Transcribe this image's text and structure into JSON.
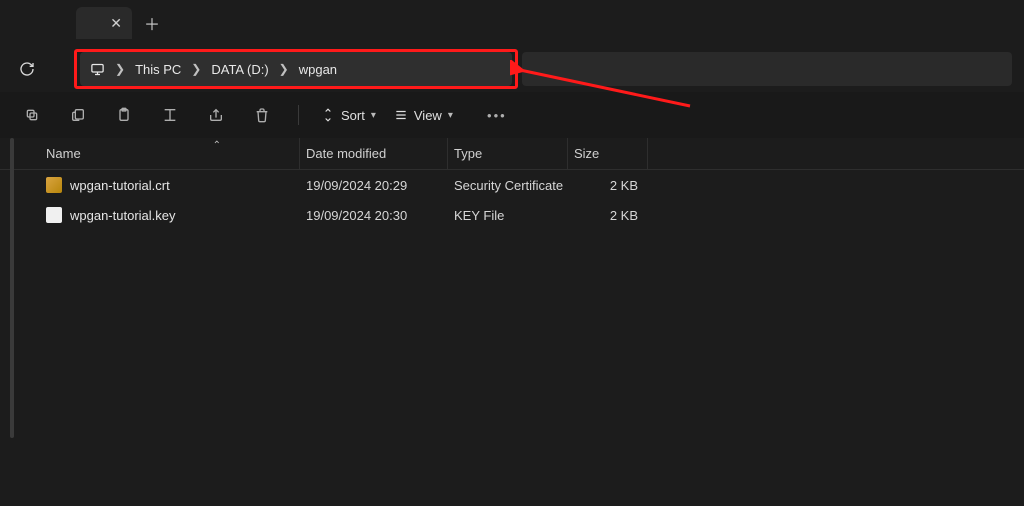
{
  "breadcrumb": {
    "items": [
      "This PC",
      "DATA (D:)",
      "wpgan"
    ]
  },
  "toolbar": {
    "sort_label": "Sort",
    "view_label": "View"
  },
  "columns": {
    "name": "Name",
    "date": "Date modified",
    "type": "Type",
    "size": "Size"
  },
  "files": [
    {
      "name": "wpgan-tutorial.crt",
      "date": "19/09/2024 20:29",
      "type": "Security Certificate",
      "size": "2 KB",
      "icon": "cert"
    },
    {
      "name": "wpgan-tutorial.key",
      "date": "19/09/2024 20:30",
      "type": "KEY File",
      "size": "2 KB",
      "icon": "key"
    }
  ]
}
